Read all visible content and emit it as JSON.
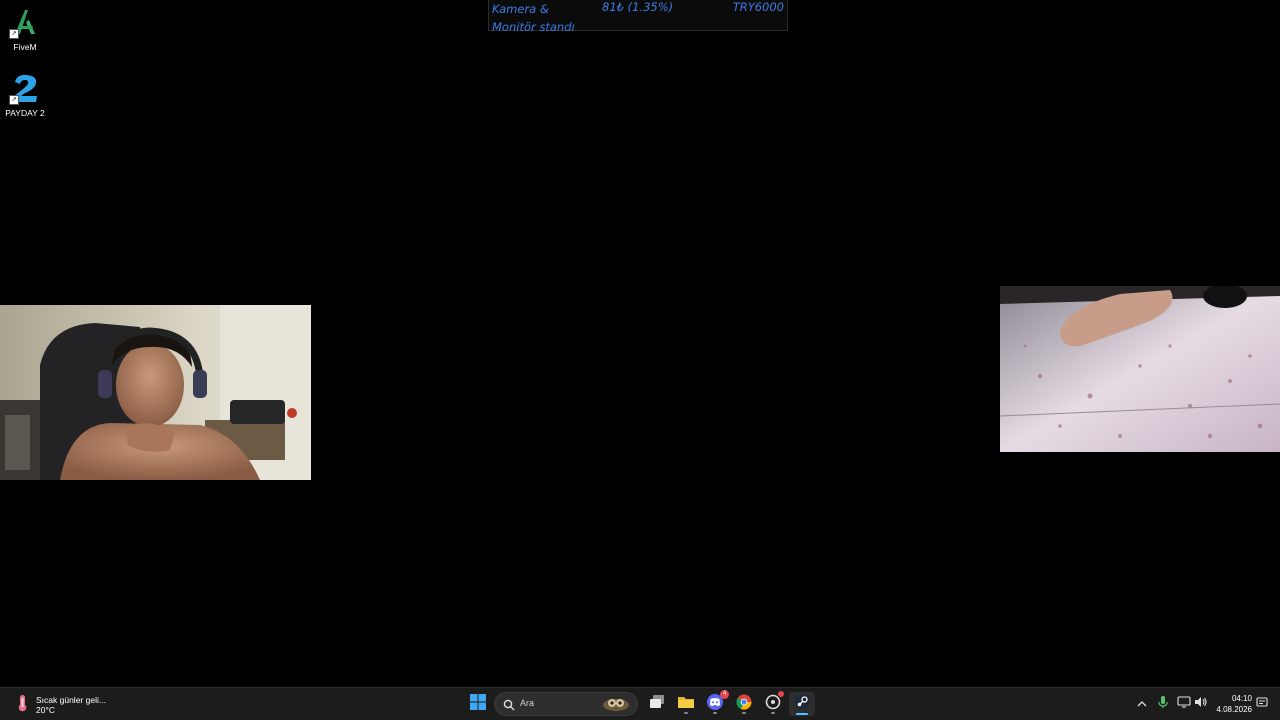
{
  "desktop": {
    "icons": [
      {
        "label": "FiveM",
        "icon": "fivem-icon"
      },
      {
        "label": "PAYDAY 2",
        "icon": "payday2-icon"
      }
    ]
  },
  "overlay": {
    "item_line1": "Kamera &",
    "item_line2": "Monitör standı",
    "amount": "81₺ (1.35%)",
    "goal": "TRY6000",
    "color": "#3c7be6"
  },
  "taskbar": {
    "weather": {
      "text": "Sıcak günler geli...",
      "temp": "20°C"
    },
    "search": {
      "placeholder": "Ara"
    },
    "apps": [
      {
        "name": "start",
        "icon": "windows-start-icon"
      },
      {
        "name": "task-view",
        "icon": "task-view-icon"
      },
      {
        "name": "file-explorer",
        "icon": "folder-icon"
      },
      {
        "name": "discord",
        "icon": "discord-icon",
        "badge": "4"
      },
      {
        "name": "chrome",
        "icon": "chrome-icon"
      },
      {
        "name": "app-recording",
        "icon": "recording-app-icon"
      },
      {
        "name": "steam",
        "icon": "steam-icon"
      }
    ],
    "clock": {
      "time": "04:10",
      "date": "4.08.2026"
    },
    "accent": "#4cc2ff"
  }
}
